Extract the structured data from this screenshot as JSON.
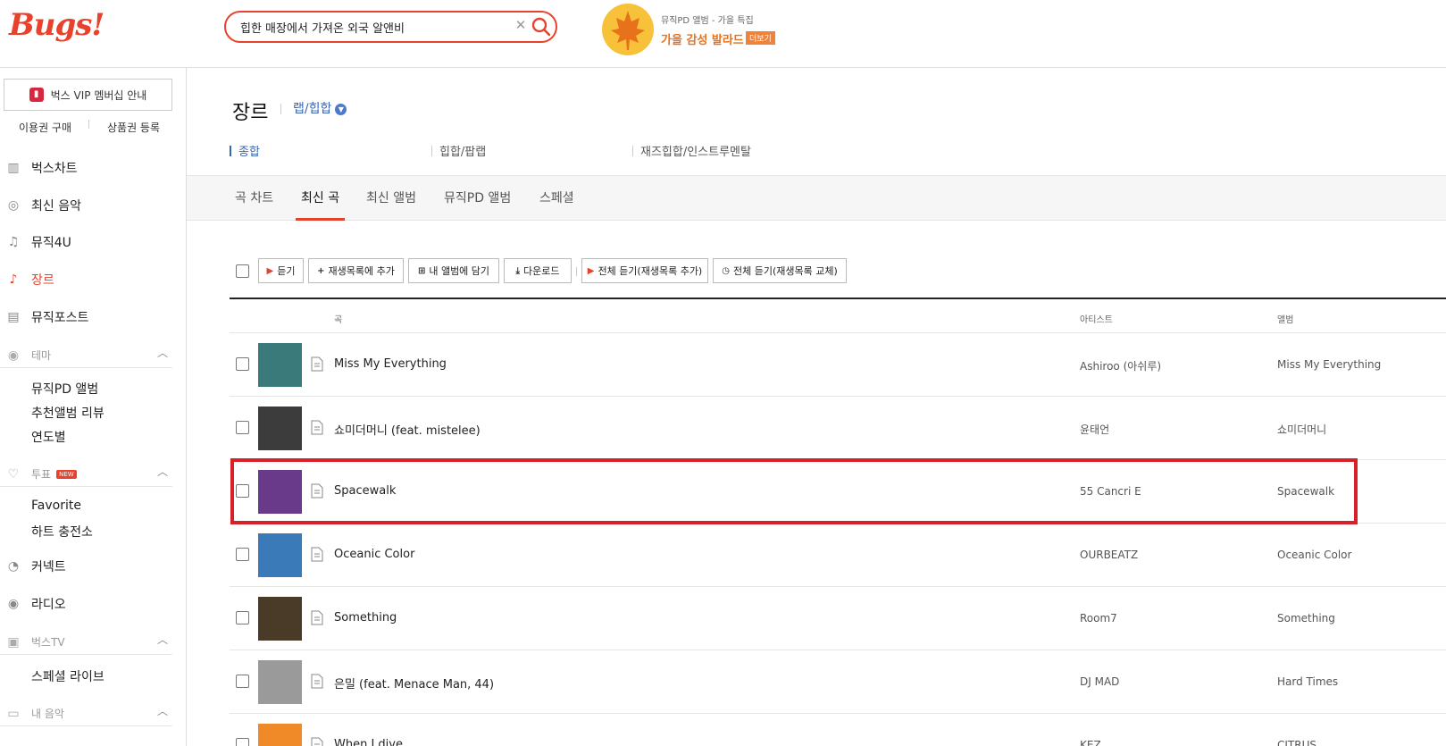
{
  "header": {
    "logo": "Bugs!",
    "search_value": "힙한 매장에서 가져온 외국 알앤비",
    "promo": {
      "subtitle": "뮤직PD 앨범 - 가을 특집",
      "title": "가을 감성 발라드",
      "more": "더보기"
    }
  },
  "sidebar": {
    "vip": "벅스 VIP 멤버십 안내",
    "buy": "이용권 구매",
    "coupon": "상품권 등록",
    "nav": {
      "chart": "벅스차트",
      "new_music": "최신 음악",
      "music4u": "뮤직4U",
      "genre": "장르",
      "musicpost": "뮤직포스트"
    },
    "theme": {
      "label": "테마",
      "items": [
        "뮤직PD 앨범",
        "추천앨범 리뷰",
        "연도별"
      ]
    },
    "vote": {
      "label": "투표",
      "badge": "NEW",
      "items": [
        "Favorite",
        "하트 충전소"
      ]
    },
    "connect": "커넥트",
    "radio": "라디오",
    "bugstv": {
      "label": "벅스TV",
      "items": [
        "스페셜 라이브"
      ]
    },
    "mymusic": "내 음악"
  },
  "main": {
    "genre_title": "장르",
    "genre_select": "랩/힙합",
    "sub_genres": [
      "종합",
      "힙합/팝랩",
      "재즈힙합/인스트루멘탈"
    ],
    "tabs": [
      "곡 차트",
      "최신 곡",
      "최신 앨범",
      "뮤직PD 앨범",
      "스페셜"
    ],
    "toolbar": {
      "listen": "듣기",
      "add_playlist": "재생목록에 추가",
      "my_album": "내 앨범에 담기",
      "download": "다운로드",
      "play_all_add": "전체 듣기(재생목록 추가)",
      "play_all_replace": "전체 듣기(재생목록 교체)"
    },
    "columns": {
      "song": "곡",
      "artist": "아티스트",
      "album": "앨범"
    },
    "songs": [
      {
        "title": "Miss My Everything",
        "artist": "Ashiroo (아쉬루)",
        "album": "Miss My Everything",
        "color": "#3a7a7a"
      },
      {
        "title": "쇼미더머니 (feat. mistelee)",
        "artist": "윤태언",
        "album": "쇼미더머니",
        "color": "#3c3c3c"
      },
      {
        "title": "Spacewalk",
        "artist": "55 Cancri E",
        "album": "Spacewalk",
        "color": "#6a3a8a"
      },
      {
        "title": "Oceanic Color",
        "artist": "OURBEATZ",
        "album": "Oceanic Color",
        "color": "#3a7ab8"
      },
      {
        "title": "Something",
        "artist": "Room7",
        "album": "Something",
        "color": "#4a3a28"
      },
      {
        "title": "은밀 (feat. Menace Man, 44)",
        "artist": "DJ MAD",
        "album": "Hard Times",
        "color": "#9a9a9a"
      },
      {
        "title": "When I dive",
        "artist": "KEZ",
        "album": "CITRUS",
        "color": "#f08a28"
      }
    ]
  }
}
